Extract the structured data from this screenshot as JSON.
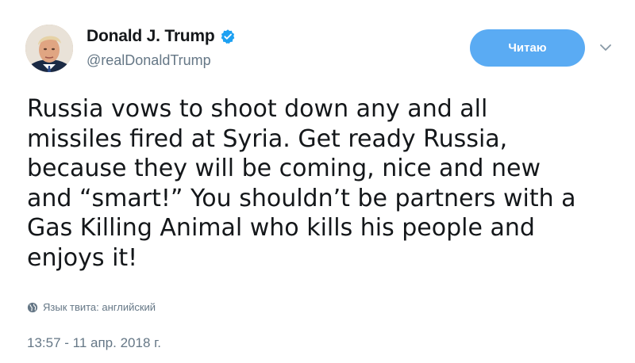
{
  "author": {
    "display_name": "Donald J. Trump",
    "handle": "@realDonaldTrump",
    "verified": true,
    "avatar_icon": "avatar-portrait"
  },
  "follow_button": {
    "label": "Читаю",
    "color": "#5aabf3"
  },
  "menu_icon": "chevron-down-icon",
  "tweet": {
    "lines": [
      "Russia vows to shoot down any and all",
      "missiles fired at Syria. Get ready Russia,",
      "because they will be coming, nice and new",
      "and “smart!” You shouldn’t be partners with a",
      "Gas Killing Animal who kills his people and",
      "enjoys it!"
    ]
  },
  "language": {
    "icon": "globe-icon",
    "label": "Язык твита: английский"
  },
  "timestamp": "13:57 - 11 апр. 2018 г."
}
